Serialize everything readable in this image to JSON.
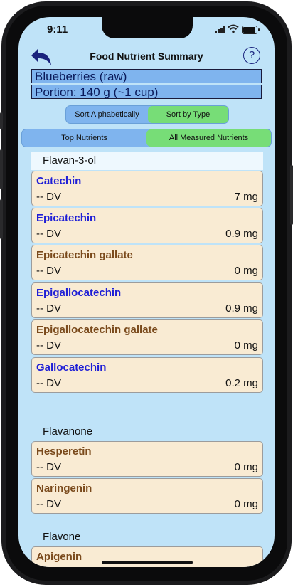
{
  "status": {
    "time": "9:11"
  },
  "nav": {
    "title": "Food Nutrient Summary",
    "help": "?"
  },
  "food": {
    "name": "Blueberries (raw)",
    "portion": "Portion: 140 g (~1 cup)"
  },
  "sort": {
    "options": [
      "Sort Alphabetically",
      "Sort by Type"
    ],
    "selected": "Sort by Type"
  },
  "filter": {
    "options": [
      "Top Nutrients",
      "All Measured Nutrients"
    ],
    "selected": "All Measured Nutrients"
  },
  "sections": [
    {
      "title": "Flavan-3-ol",
      "items": [
        {
          "name": "Catechin",
          "dv": "-- DV",
          "amount": "7 mg",
          "color": "#1f1fd6"
        },
        {
          "name": "Epicatechin",
          "dv": "-- DV",
          "amount": "0.9 mg",
          "color": "#1f1fd6"
        },
        {
          "name": "Epicatechin gallate",
          "dv": "-- DV",
          "amount": "0 mg",
          "color": "#7a4a1c"
        },
        {
          "name": "Epigallocatechin",
          "dv": "-- DV",
          "amount": "0.9 mg",
          "color": "#1f1fd6"
        },
        {
          "name": "Epigallocatechin gallate",
          "dv": "-- DV",
          "amount": "0 mg",
          "color": "#7a4a1c"
        },
        {
          "name": "Gallocatechin",
          "dv": "-- DV",
          "amount": "0.2 mg",
          "color": "#1f1fd6"
        }
      ]
    },
    {
      "title": "Flavanone",
      "items": [
        {
          "name": "Hesperetin",
          "dv": "-- DV",
          "amount": "0 mg",
          "color": "#7a4a1c"
        },
        {
          "name": "Naringenin",
          "dv": "-- DV",
          "amount": "0 mg",
          "color": "#7a4a1c"
        }
      ]
    },
    {
      "title": "Flavone",
      "items": [
        {
          "name": "Apigenin",
          "dv": "",
          "amount": "",
          "color": "#7a4a1c"
        }
      ]
    }
  ],
  "colors": {
    "background": "#bfe3f8",
    "accent": "#7fb4ee",
    "selected": "#77dd77",
    "card": "#f9ebd3"
  }
}
